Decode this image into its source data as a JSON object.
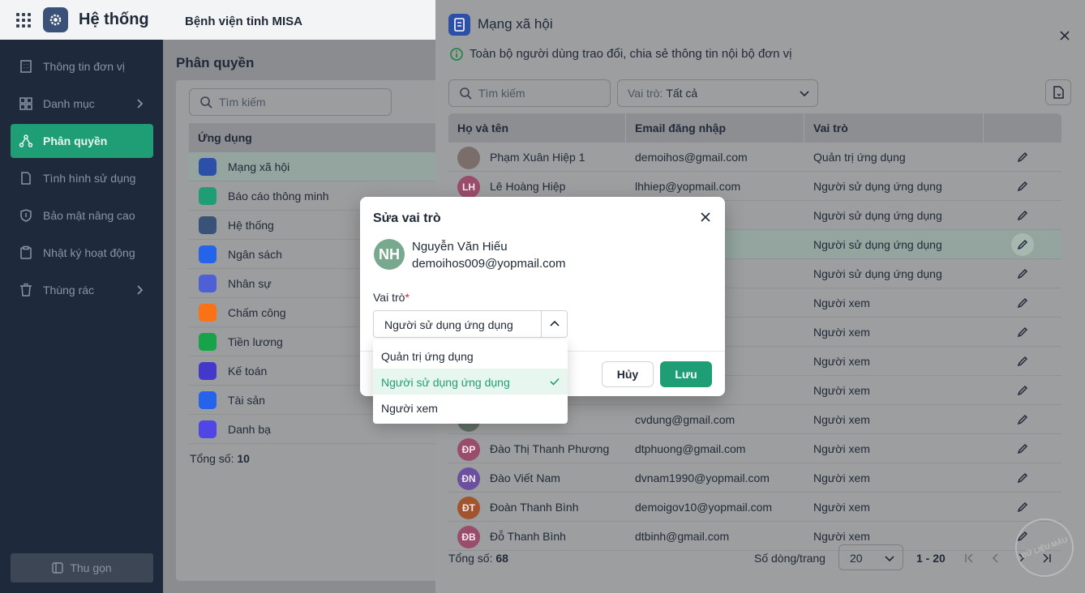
{
  "topbar": {
    "app_title": "Hệ thống",
    "org_name": "Bệnh viện tỉnh MISA"
  },
  "sidebar": {
    "items": [
      {
        "label": "Thông tin đơn vị",
        "icon": "building-icon"
      },
      {
        "label": "Danh mục",
        "icon": "grid-icon",
        "has_submenu": true
      },
      {
        "label": "Phân quyền",
        "icon": "share-nodes-icon",
        "active": true
      },
      {
        "label": "Tình hình sử dụng",
        "icon": "document-icon"
      },
      {
        "label": "Bảo mật nâng cao",
        "icon": "shield-icon"
      },
      {
        "label": "Nhật ký hoạt động",
        "icon": "clipboard-icon"
      },
      {
        "label": "Thùng rác",
        "icon": "trash-icon",
        "has_submenu": true
      }
    ],
    "collapse_label": "Thu gọn"
  },
  "permissions": {
    "title": "Phân quyền",
    "search_placeholder": "Tìm kiếm",
    "list_header": "Ứng dụng",
    "apps": [
      {
        "label": "Mạng xã hội",
        "color": "#2c4fa8"
      },
      {
        "label": "Báo cáo thông minh",
        "color": "#1f9d74"
      },
      {
        "label": "Hệ thống",
        "color": "#3b5278"
      },
      {
        "label": "Ngân sách",
        "color": "#2563eb"
      },
      {
        "label": "Nhân sự",
        "color": "#4f5fd6"
      },
      {
        "label": "Chấm công",
        "color": "#f97316"
      },
      {
        "label": "Tiền lương",
        "color": "#16a34a"
      },
      {
        "label": "Kế toán",
        "color": "#4338ca"
      },
      {
        "label": "Tài sản",
        "color": "#2563eb"
      },
      {
        "label": "Danh bạ",
        "color": "#4f46e5"
      }
    ],
    "total_label": "Tổng số:",
    "total_value": "10"
  },
  "drawer": {
    "title": "Mạng xã hội",
    "description": "Toàn bộ người dùng trao đổi, chia sẻ thông tin nội bộ đơn vị",
    "search_placeholder": "Tìm kiếm",
    "role_filter_label": "Vai trò:",
    "role_filter_value": "Tất cả",
    "columns": [
      "Họ và tên",
      "Email đăng nhập",
      "Vai trò"
    ],
    "rows": [
      {
        "initials": "",
        "name": "Phạm Xuân Hiệp 1",
        "email": "demoihos@gmail.com",
        "role": "Quản trị ứng dụng",
        "avatar_color": "#7a6d6a"
      },
      {
        "initials": "LH",
        "name": "Lê Hoàng Hiệp",
        "email": "lhhiep@yopmail.com",
        "role": "Người sử dụng ứng dụng",
        "avatar_color": "#9a4d6a"
      },
      {
        "initials": "",
        "name": "",
        "email": "ail.com",
        "role": "Người sử dụng ứng dụng",
        "avatar_color": "#8d8e91"
      },
      {
        "initials": "",
        "name": "",
        "email": "opmail.com",
        "role": "Người sử dụng ứng dụng",
        "avatar_color": "#8d8e91",
        "selected": true
      },
      {
        "initials": "",
        "name": "",
        "email": "mail.com",
        "role": "Người sử dụng ứng dụng",
        "avatar_color": "#8d8e91"
      },
      {
        "initials": "",
        "name": "",
        "email": "",
        "role": "Người xem",
        "avatar_color": "#8d8e91"
      },
      {
        "initials": "",
        "name": "",
        "email": "om",
        "role": "Người xem",
        "avatar_color": "#8d8e91"
      },
      {
        "initials": "",
        "name": "",
        "email": "m",
        "role": "Người xem",
        "avatar_color": "#8d8e91"
      },
      {
        "initials": "",
        "name": "",
        "email": "m",
        "role": "Người xem",
        "avatar_color": "#8d8e91"
      },
      {
        "initials": "",
        "name": "",
        "email": "cvdung@gmail.com",
        "role": "Người xem",
        "avatar_color": "#5f6f66"
      },
      {
        "initials": "ĐP",
        "name": "Đào Thị Thanh Phương",
        "email": "dtphuong@gmail.com",
        "role": "Người xem",
        "avatar_color": "#9a4d6a"
      },
      {
        "initials": "ĐN",
        "name": "Đào Viết Nam",
        "email": "dvnam1990@yopmail.com",
        "role": "Người xem",
        "avatar_color": "#6b4fa0"
      },
      {
        "initials": "ĐT",
        "name": "Đoàn Thanh Bình",
        "email": "demoigov10@yopmail.com",
        "role": "Người xem",
        "avatar_color": "#a2542e"
      },
      {
        "initials": "ĐB",
        "name": "Đỗ Thanh Bình",
        "email": "dtbinh@gmail.com",
        "role": "Người xem",
        "avatar_color": "#9a4d6a"
      }
    ],
    "total_label": "Tổng số:",
    "total_value": "68",
    "rows_per_page_label": "Số dòng/trang",
    "rows_per_page": "20",
    "range": "1 - 20"
  },
  "dialog": {
    "title": "Sửa vai trò",
    "user_initials": "NH",
    "user_name": "Nguyễn Văn Hiếu",
    "user_email": "demoihos009@yopmail.com",
    "role_label": "Vai trò",
    "required_mark": "*",
    "selected_role": "Người sử dụng ứng dụng",
    "options": [
      "Quản trị ứng dụng",
      "Người sử dụng ứng dụng",
      "Người xem"
    ],
    "cancel_label": "Hủy",
    "save_label": "Lưu"
  },
  "watermark": "ĐỮ LIỆU MẪU",
  "colors": {
    "accent": "#1f9d74",
    "sidebar_bg": "#1e293b"
  }
}
